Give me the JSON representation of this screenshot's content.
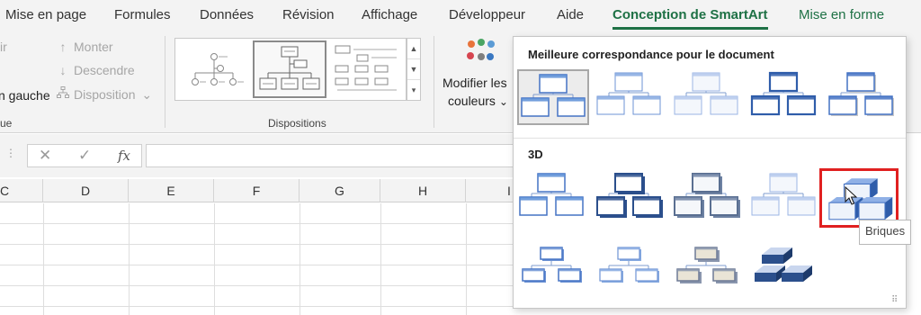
{
  "tabs": [
    {
      "label": "Mise en page",
      "state": "normal"
    },
    {
      "label": "Formules",
      "state": "normal"
    },
    {
      "label": "Données",
      "state": "normal"
    },
    {
      "label": "Révision",
      "state": "normal"
    },
    {
      "label": "Affichage",
      "state": "normal"
    },
    {
      "label": "Développeur",
      "state": "normal"
    },
    {
      "label": "Aide",
      "state": "normal"
    },
    {
      "label": "Conception de SmartArt",
      "state": "active"
    },
    {
      "label": "Mise en forme",
      "state": "contextual"
    }
  ],
  "ribbon": {
    "create_graphic": {
      "partial_top": "ir",
      "partial_gauche": "n gauche",
      "partial_group": "ue",
      "monter": "Monter",
      "descendre": "Descendre",
      "disposition": "Disposition",
      "disposition_arrow": "⌄"
    },
    "layouts_group_label": "Dispositions",
    "modifier_couleurs_line1": "Modifier les",
    "modifier_couleurs_line2": "couleurs",
    "modifier_couleurs_arrow": "⌄",
    "color_dots": [
      "#e8743b",
      "#4aa564",
      "#5b9bd5",
      "#d64550",
      "#7f7f7f",
      "#3a78c2"
    ]
  },
  "formula_bar": {
    "cancel": "✕",
    "enter": "✓",
    "fx": "fx",
    "value": ""
  },
  "columns": [
    "C",
    "D",
    "E",
    "F",
    "G",
    "H",
    "I"
  ],
  "dropdown": {
    "section_best": "Meilleure correspondance pour le document",
    "section_3d": "3D",
    "tooltip": "Briques",
    "selected_style": "best-1",
    "hovered_style": "3d-5"
  },
  "colors": {
    "accent_green": "#1e7145",
    "smartart_blue": "#4472c4",
    "highlight_red": "#e02020"
  },
  "icons": {
    "monter": "arrow-up-icon",
    "descendre": "arrow-down-icon",
    "disposition": "org-chart-icon",
    "palette": "palette-dots-icon"
  }
}
